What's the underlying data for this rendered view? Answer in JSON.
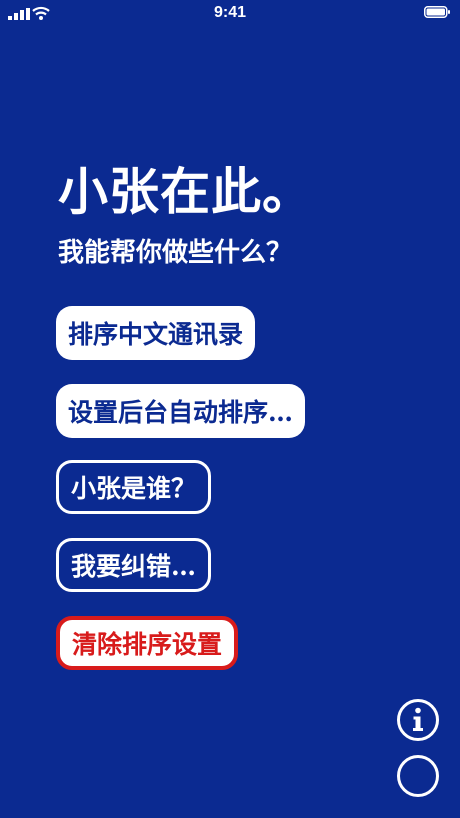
{
  "status": {
    "time": "9:41"
  },
  "headline": "小张在此。",
  "subline": "我能帮你做些什么？",
  "options": [
    {
      "label": "排序中文通讯录"
    },
    {
      "label": "设置后台自动排序…"
    },
    {
      "label": "小张是谁？"
    },
    {
      "label": "我要纠错…"
    },
    {
      "label": "清除排序设置"
    }
  ],
  "colors": {
    "background": "#0b2a91",
    "foreground": "#ffffff",
    "danger": "#d81b1b"
  },
  "icons": {
    "info": "info-icon",
    "circle": "circle-icon"
  }
}
